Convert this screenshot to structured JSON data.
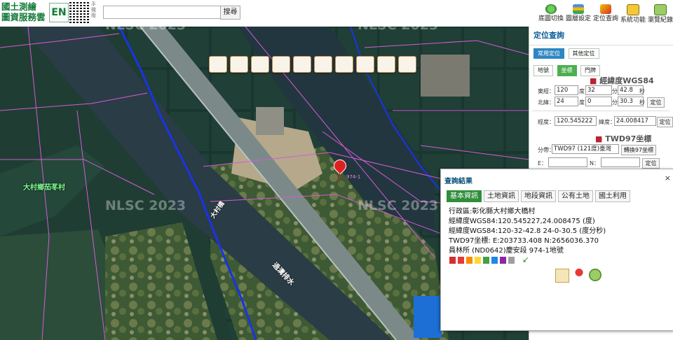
{
  "header": {
    "logo_line1": "國土測繪",
    "logo_line2": "圖資服務雲",
    "lang_button": "EN",
    "mobile_label": "手機版",
    "search_placeholder": "",
    "search_button": "搜尋",
    "tools": [
      "底圖切換",
      "圖層設定",
      "定位查詢",
      "系統功能",
      "瀏覽紀錄"
    ]
  },
  "map": {
    "watermark": "NLSC 2023",
    "place_label": "大村鄉茄苳村",
    "road_label": "過溝排水",
    "bridge_label": "大村橋",
    "parcel_label": "974-1",
    "toolbar_icons": [
      "fullscreen-icon",
      "building-icon",
      "undo-icon",
      "redo-icon",
      "pan-icon",
      "measure-icon",
      "line-icon",
      "comment-icon",
      "eraser-icon",
      "clear-icon"
    ]
  },
  "panel": {
    "title": "定位查詢",
    "mode_tabs": [
      "常用定位",
      "其他定位"
    ],
    "subtabs": [
      "地號",
      "坐標",
      "門牌"
    ],
    "wgs_title": "經緯度WGS84",
    "east_label": "東經：",
    "north_label": "北緯：",
    "east_deg": "120",
    "east_min": "32",
    "east_sec": "42.8",
    "north_deg": "24",
    "north_min": "0",
    "north_sec": "30.3",
    "deg": "度",
    "min": "分",
    "sec": "秒",
    "locate": "定位",
    "lng_label": "經度：",
    "lng_value": "120.545222",
    "lat_label": "緯度：",
    "lat_value": "24.008417",
    "twd_title": "TWD97坐標",
    "zone_label": "分帶：",
    "zone_value": "TWD97 (121度)臺灣",
    "convert_btn": "轉換97坐標",
    "e_label": "E：",
    "n_label": "N："
  },
  "popup": {
    "title": "查詢結果",
    "close": "×",
    "tabs": [
      "基本資訊",
      "土地資訊",
      "地段資訊",
      "公有土地",
      "國土利用"
    ],
    "lines": [
      "行政區:彰化縣大村鄉大橋村",
      "經緯度WGS84:120.545227,24.008475 (度)",
      "經緯度WGS84:120-32-42.8 24-0-30.5 (度分秒)",
      "TWD97坐標: E:203733.408 N:2656036.370",
      "員林所 (ND0642)慶安段 974-1地號"
    ],
    "swatch_colors": [
      "#d32f2f",
      "#e53935",
      "#fb8c00",
      "#fdd835",
      "#43a047",
      "#1e88e5",
      "#8e24aa",
      "#9e9e9e"
    ]
  }
}
